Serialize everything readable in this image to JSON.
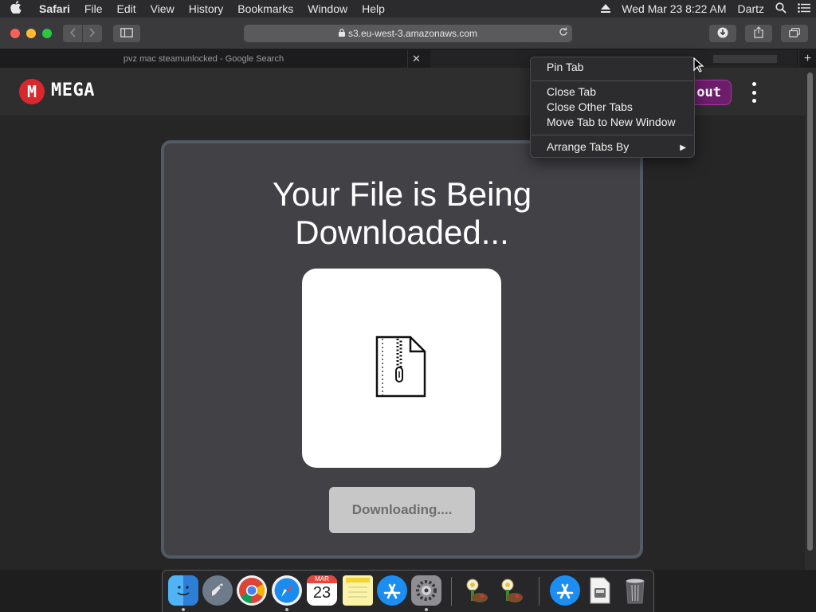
{
  "menubar": {
    "app_name": "Safari",
    "menus": [
      "File",
      "Edit",
      "View",
      "History",
      "Bookmarks",
      "Window",
      "Help"
    ],
    "datetime": "Wed Mar 23  8:22 AM",
    "user": "Dartz"
  },
  "toolbar": {
    "address": "s3.eu-west-3.amazonaws.com"
  },
  "tabs": {
    "tab1_title": "pvz mac steamunlocked - Google Search"
  },
  "header": {
    "logo_letter": "M",
    "logo_text": "MEGA",
    "checkout_label": "out"
  },
  "card": {
    "title_line1": "Your File is Being",
    "title_line2": "Downloaded...",
    "status_label": "Downloading...."
  },
  "context_menu": {
    "items": [
      "Pin Tab",
      "Close Tab",
      "Close Other Tabs",
      "Move Tab to New Window",
      "Arrange Tabs By"
    ]
  },
  "dock": {
    "calendar_month": "MAR",
    "calendar_day": "23"
  },
  "colors": {
    "accent_red": "#d9272e",
    "checkout_purple": "#6e1d6b",
    "card_bg": "#414146",
    "card_border": "#525a66"
  }
}
